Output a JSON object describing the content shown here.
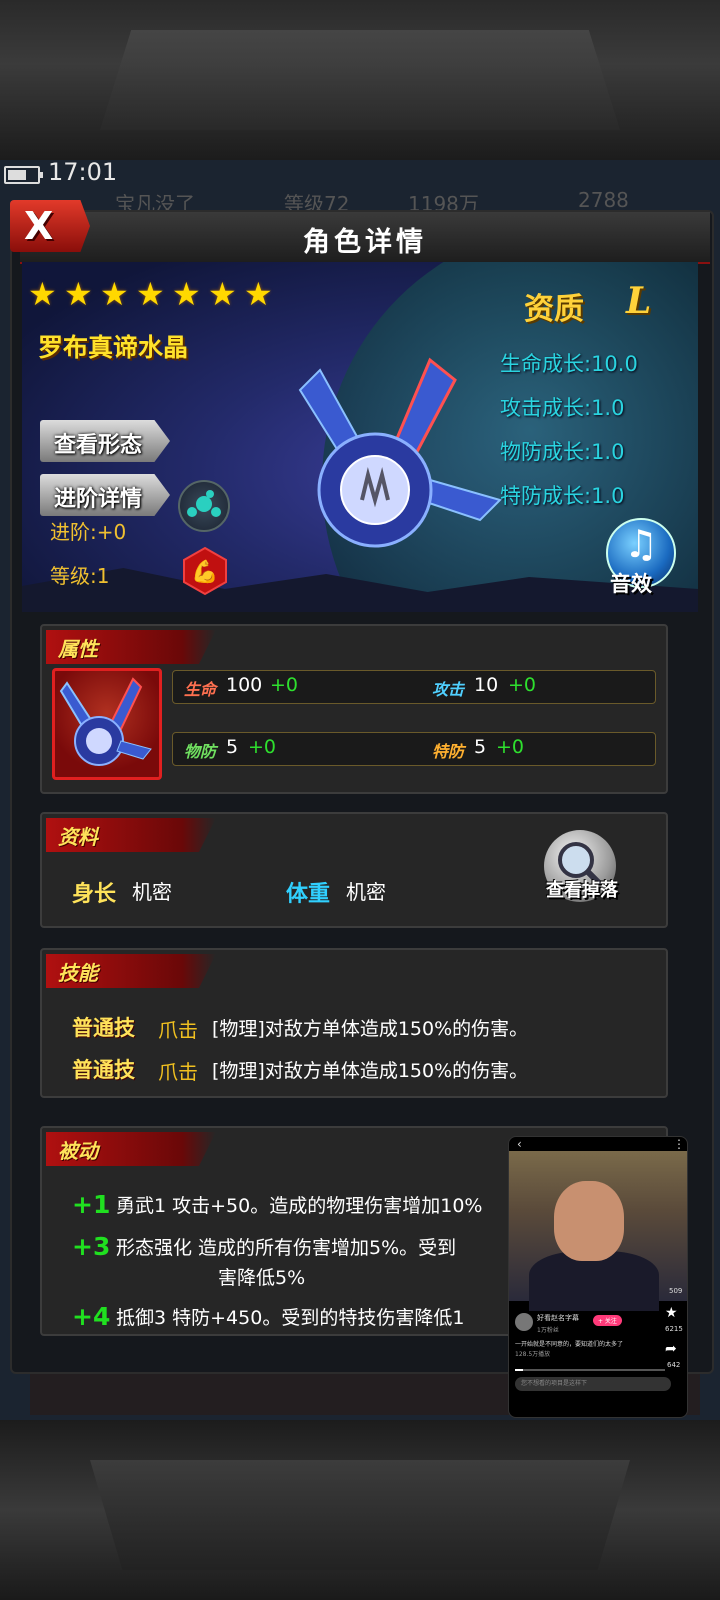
{
  "status": {
    "time": "17:01"
  },
  "background_bar": {
    "ghost_name": "宝凡没了",
    "ghost_level": "等级72",
    "ghost_gold": "1198万",
    "ghost_gems": "2788"
  },
  "window": {
    "title": "角色详情",
    "close_label": "X"
  },
  "hero": {
    "stars": 7,
    "name": "罗布真谛水晶",
    "buttons": {
      "view_form": "查看形态",
      "advance_detail": "进阶详情"
    },
    "advance": "进阶:+0",
    "level": "等级:1",
    "aptitude_label": "资质",
    "aptitude_value": "L",
    "growth": [
      "生命成长:10.0",
      "攻击成长:1.0",
      "物防成长:1.0",
      "特防成长:1.0"
    ],
    "sound_label": "音效"
  },
  "attributes": {
    "title": "属性",
    "hp": {
      "label": "生命",
      "value": "100",
      "plus": "+0"
    },
    "atk": {
      "label": "攻击",
      "value": "10",
      "plus": "+0"
    },
    "pdef": {
      "label": "物防",
      "value": "5",
      "plus": "+0"
    },
    "sdef": {
      "label": "特防",
      "value": "5",
      "plus": "+0"
    }
  },
  "profile": {
    "title": "资料",
    "height_label": "身长",
    "height_value": "机密",
    "weight_label": "体重",
    "weight_value": "机密",
    "drop_button": "查看掉落"
  },
  "skills": {
    "title": "技能",
    "items": [
      {
        "kind": "普通技",
        "name": "爪击",
        "desc": "[物理]对敌方单体造成150%的伤害。"
      },
      {
        "kind": "普通技",
        "name": "爪击",
        "desc": "[物理]对敌方单体造成150%的伤害。"
      }
    ]
  },
  "passive": {
    "title": "被动",
    "items": [
      {
        "level": "+1",
        "text": "勇武1  攻击+50。造成的物理伤害增加10%"
      },
      {
        "level": "+3",
        "text": "形态强化  造成的所有伤害增加5%。受到",
        "text2": "害降低5%"
      },
      {
        "level": "+4",
        "text": "抵御3  特防+450。受到的特技伤害降低1"
      }
    ]
  },
  "pip": {
    "channel": "好看赵名字幕",
    "fans": "1万粉丝",
    "follow": "+ 关注",
    "caption": "一开始就是不同意的，要知道们的太多了",
    "views": "128.5万播放",
    "comment_placeholder": "您不想看的项目是这样下",
    "counts": [
      "509",
      "6215",
      "642"
    ]
  }
}
